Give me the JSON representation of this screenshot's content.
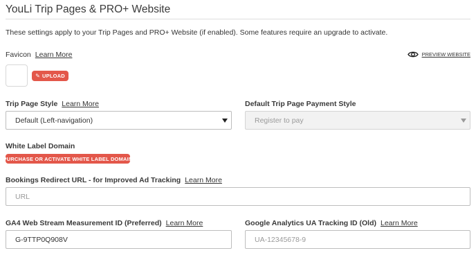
{
  "page": {
    "title": "YouLi Trip Pages & PRO+ Website",
    "intro": "These settings apply to your Trip Pages and PRO+ Website (if enabled). Some features require an upgrade to activate."
  },
  "favicon": {
    "label": "Favicon",
    "learn_more": "Learn More",
    "upload_label": "UPLOAD",
    "upload_icon": "pencil-icon"
  },
  "preview": {
    "label": "PREVIEW WEBSITE",
    "icon": "eye-icon"
  },
  "trip_page_style": {
    "label": "Trip Page Style",
    "learn_more": "Learn More",
    "selected": "Default (Left-navigation)"
  },
  "payment_style": {
    "label": "Default Trip Page Payment Style",
    "selected": "Register to pay"
  },
  "white_label": {
    "label": "White Label Domain",
    "button": "PURCHASE OR ACTIVATE WHITE LABEL DOMAIN"
  },
  "bookings_redirect": {
    "label": "Bookings Redirect URL - for Improved Ad Tracking",
    "learn_more": "Learn More",
    "placeholder": "URL"
  },
  "ga4": {
    "label": "GA4 Web Stream Measurement ID (Preferred)",
    "learn_more": "Learn More",
    "value": "G-9TTP0Q908V"
  },
  "ua": {
    "label": "Google Analytics UA Tracking ID (Old)",
    "learn_more": "Learn More",
    "placeholder": "UA-12345678-9"
  },
  "colors": {
    "accent_red": "#e3574a",
    "border": "#bdbdbd",
    "disabled_bg": "#f2f2f2"
  }
}
